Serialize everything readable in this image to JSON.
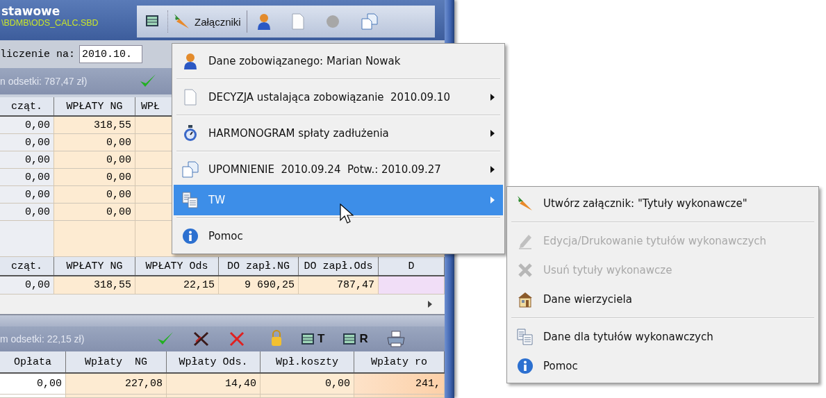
{
  "window": {
    "title": "stawowe",
    "path": "\\BDMB\\ODS_CALC.SBD"
  },
  "toolbar": {
    "attachments_button": "Załączniki"
  },
  "date_field": {
    "label": "liczenie na:",
    "value": "2010.10."
  },
  "upper_panel": {
    "summary": "n odsetki: 787,47 zł)",
    "columns": [
      "cząt.",
      "WPŁATY NG",
      "WPŁ"
    ],
    "rows": [
      [
        "0,00",
        "318,55"
      ],
      [
        "0,00",
        "0,00"
      ],
      [
        "0,00",
        "0,00"
      ],
      [
        "0,00",
        "0,00"
      ],
      [
        "0,00",
        "0,00"
      ],
      [
        "0,00",
        "0,00"
      ]
    ]
  },
  "totals": {
    "columns": [
      "cząt.",
      "WPŁATY NG",
      "WPŁATY Ods",
      "DO zapł.NG",
      "DO zapł.Ods",
      "D"
    ],
    "row": [
      "0,00",
      "318,55",
      "22,15",
      "9 690,25",
      "787,47"
    ]
  },
  "lower_panel": {
    "summary": "m odsetki: 22,15 zł)",
    "tool_labels": [
      "T",
      "R"
    ],
    "columns": [
      "Opłata",
      "Wpłaty  NG",
      "Wpłaty Ods.",
      "Wpł.koszty",
      "Wpłaty ro"
    ],
    "rows": [
      [
        "0,00",
        "227,08",
        "14,40",
        "0,00",
        "241,"
      ]
    ]
  },
  "context_menu": [
    {
      "kind": "item",
      "label": "Dane zobowiązanego: Marian Nowak",
      "selected": false,
      "has_submenu": false
    },
    {
      "kind": "separator"
    },
    {
      "kind": "item",
      "label": "DECYZJA ustalająca zobowiązanie  2010.09.10",
      "selected": false,
      "has_submenu": true
    },
    {
      "kind": "separator"
    },
    {
      "kind": "item",
      "label": "HARMONOGRAM spłaty zadłużenia",
      "selected": false,
      "has_submenu": true
    },
    {
      "kind": "separator"
    },
    {
      "kind": "item",
      "label": "UPOMNIENIE  2010.09.24  Potw.: 2010.09.27",
      "selected": false,
      "has_submenu": true
    },
    {
      "kind": "item",
      "label": "TW",
      "selected": true,
      "has_submenu": true
    },
    {
      "kind": "separator"
    },
    {
      "kind": "item",
      "label": "Pomoc",
      "selected": false,
      "has_submenu": false
    }
  ],
  "submenu": [
    {
      "kind": "item",
      "label": "Utwórz załącznik: \"Tytuły wykonawcze\"",
      "disabled": false
    },
    {
      "kind": "separator"
    },
    {
      "kind": "item",
      "label": "Edycja/Drukowanie tytułów wykonawczych",
      "disabled": true
    },
    {
      "kind": "item",
      "label": "Usuń tytuły wykonawcze",
      "disabled": true
    },
    {
      "kind": "item",
      "label": "Dane wierzyciela",
      "disabled": false
    },
    {
      "kind": "separator"
    },
    {
      "kind": "item",
      "label": "Dane dla tytułów wykonawczych",
      "disabled": false
    },
    {
      "kind": "item",
      "label": "Pomoc",
      "disabled": false
    }
  ]
}
